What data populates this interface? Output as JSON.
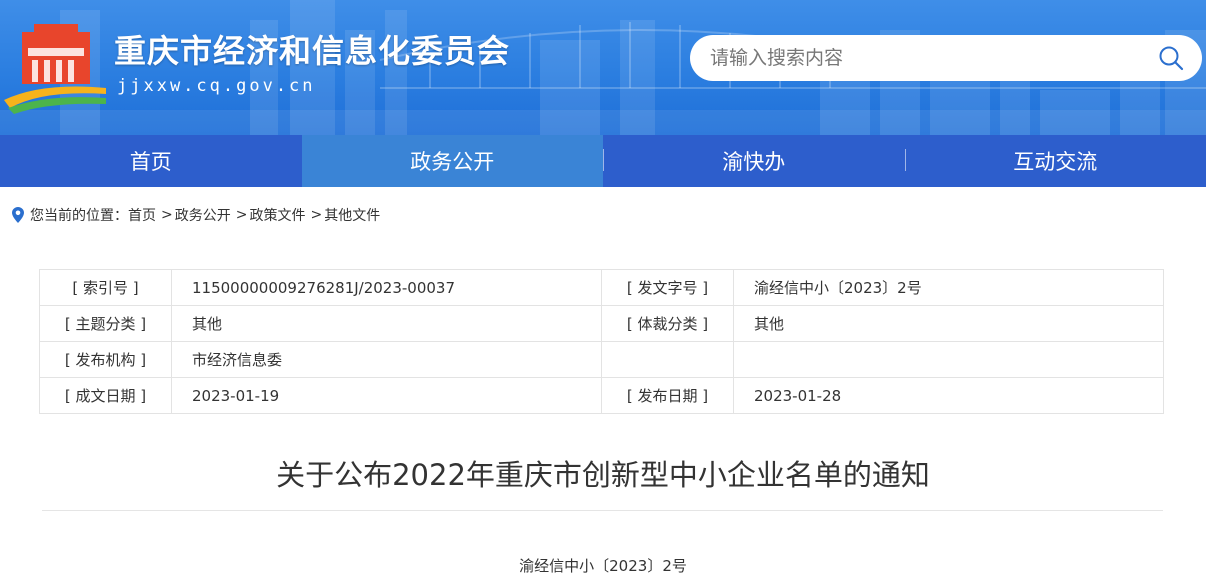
{
  "site": {
    "title": "重庆市经济和信息化委员会",
    "domain": "jjxxw.cq.gov.cn"
  },
  "search": {
    "placeholder": "请输入搜索内容",
    "value": ""
  },
  "colors": {
    "header_blue": "#2b7ee0",
    "nav_blue": "#2d5ecc",
    "nav_active": "#3a84d6",
    "pin_blue": "#2b6fce"
  },
  "nav": {
    "items": [
      {
        "label": "首页"
      },
      {
        "label": "政务公开"
      },
      {
        "label": "渝快办"
      },
      {
        "label": "互动交流"
      }
    ],
    "active": "政务公开"
  },
  "breadcrumb": {
    "prefix": "您当前的位置：",
    "items": [
      "首页",
      "政务公开",
      "政策文件",
      "其他文件"
    ],
    "separator": ">"
  },
  "meta_table": {
    "rows": [
      [
        "[ 索引号 ]",
        "11500000009276281J/2023-00037",
        "[ 发文字号 ]",
        "渝经信中小〔2023〕2号"
      ],
      [
        "[ 主题分类 ]",
        "其他",
        "[ 体裁分类 ]",
        "其他"
      ],
      [
        "[ 发布机构 ]",
        "市经济信息委",
        "",
        ""
      ],
      [
        "[ 成文日期 ]",
        "2023-01-19",
        "[ 发布日期 ]",
        "2023-01-28"
      ]
    ]
  },
  "document": {
    "title": "关于公布2022年重庆市创新型中小企业名单的通知",
    "number": "渝经信中小〔2023〕2号"
  }
}
